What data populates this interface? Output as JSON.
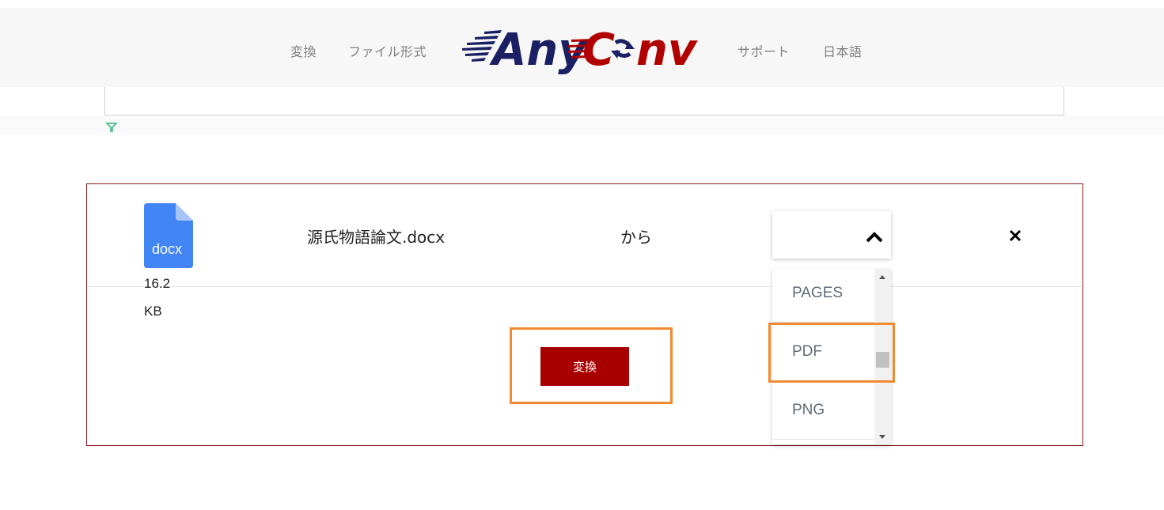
{
  "nav": {
    "left_items": [
      "変換",
      "ファイル形式"
    ],
    "right_items": [
      "サポート",
      "日本語"
    ]
  },
  "logo": {
    "text_any": "Any",
    "text_conv_c": "C",
    "text_conv_nv": "nv"
  },
  "file": {
    "icon_label": "docx",
    "size_value": "16.2",
    "size_unit": "KB",
    "name": "源氏物語論文.docx"
  },
  "from_label": "から",
  "dropdown": {
    "options": [
      "PAGES",
      "PDF",
      "PNG"
    ]
  },
  "convert_button": "変換",
  "colors": {
    "brand_navy": "#1a2063",
    "brand_red": "#b00000",
    "button_red": "#a80000",
    "highlight_orange": "#f28a30",
    "file_icon_blue": "#4285f4"
  }
}
